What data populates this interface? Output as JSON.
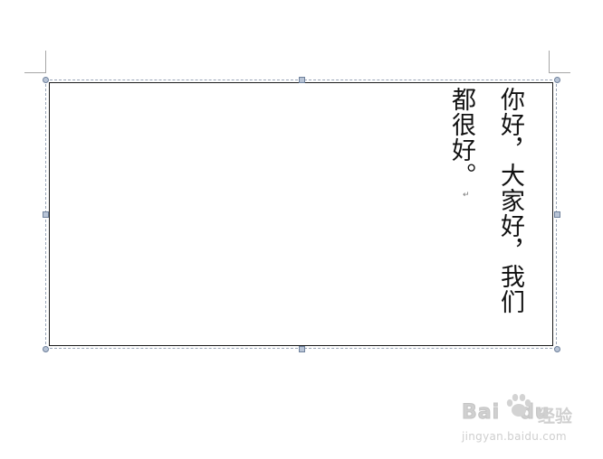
{
  "textbox": {
    "line1": "你好，大家好，我们",
    "line2": "都很好。"
  },
  "watermark": {
    "logo_text": "Bai",
    "logo_text_2": "du",
    "suffix": "经验",
    "url": "jingyan.baidu.com"
  },
  "colors": {
    "handle_fill": "#b8c4d6",
    "handle_border": "#6f819c",
    "frame_dash": "#9aa6b8",
    "text": "#111111"
  }
}
